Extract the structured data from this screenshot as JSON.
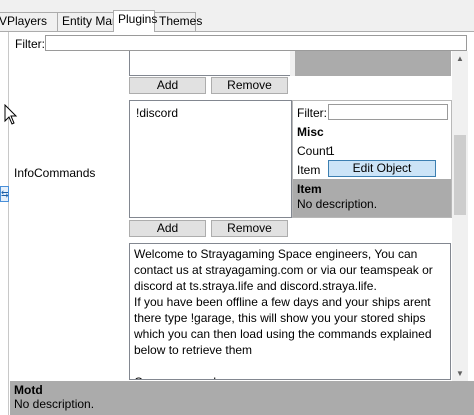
{
  "tabs": [
    {
      "label": "VPlayers"
    },
    {
      "label": "Entity Manager"
    },
    {
      "label": "Plugins"
    },
    {
      "label": "Themes"
    }
  ],
  "active_tab": "Plugins",
  "filter": {
    "label": "Filter:",
    "value": ""
  },
  "buttons": {
    "add": "Add",
    "remove": "Remove"
  },
  "infocommands": {
    "label": "InfoCommands",
    "items": [
      "!discord"
    ],
    "inspector": {
      "filter_label": "Filter:",
      "filter_value": "",
      "category": "Misc",
      "rows": [
        {
          "name": "Count",
          "value": "1"
        },
        {
          "name": "Item",
          "value": "Edit Object"
        }
      ],
      "desc_title": "Item",
      "desc_text": "No description."
    }
  },
  "motd_text": "Welcome to Strayagaming Space engineers, You can contact us at strayagaming.com or via our teamspeak or discord at ts.straya.life and discord.straya.life.\nIf you have been offline a few days and your ships arent there type !garage, this will show you your stored ships which you can then load using the commands explained below to retrieve them\n\nCore commands:\nPlease note it is recommended to not use the store command on planetbound stations as it will be impossible to put them back in place.",
  "footer": {
    "title": "Motd",
    "text": "No description."
  }
}
